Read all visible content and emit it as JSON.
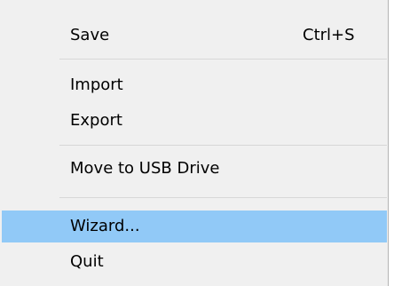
{
  "menu": {
    "items": [
      {
        "label": "Save",
        "shortcut": "Ctrl+S"
      },
      {
        "label": "Import"
      },
      {
        "label": "Export"
      },
      {
        "label": "Move to USB Drive"
      },
      {
        "label": "Wizard..."
      },
      {
        "label": "Quit"
      }
    ],
    "highlighted_item": "Wizard...",
    "colors": {
      "background": "#f0f0f0",
      "highlight": "#91c9f7",
      "separator": "#d7d7d7",
      "text": "#000000"
    }
  }
}
